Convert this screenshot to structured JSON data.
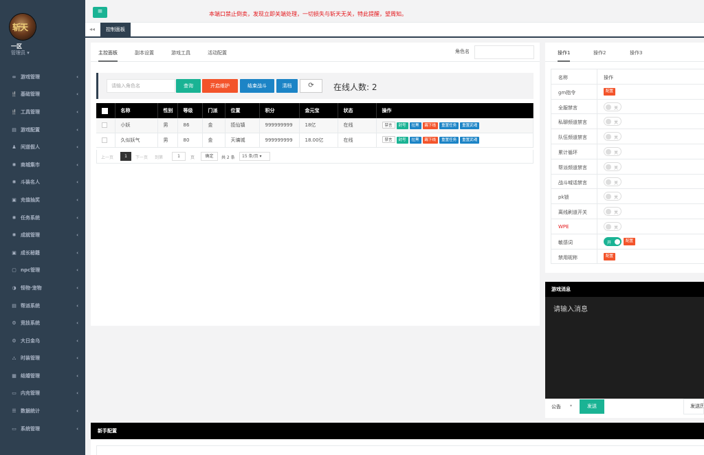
{
  "sidebar": {
    "logo_text": "斩天",
    "user": {
      "name": "一区",
      "role": "管理员 ▾"
    },
    "items": [
      {
        "icon": "∞",
        "label": "游戏管理"
      },
      {
        "icon": "🍴",
        "label": "基础管理"
      },
      {
        "icon": "🍴",
        "label": "工具管理"
      },
      {
        "icon": "▤",
        "label": "游戏配置"
      },
      {
        "icon": "♟",
        "label": "间道假人"
      },
      {
        "icon": "✺",
        "label": "商城集市"
      },
      {
        "icon": "✺",
        "label": "斗装名人"
      },
      {
        "icon": "▣",
        "label": "充值抽奖"
      },
      {
        "icon": "✺",
        "label": "任务系统"
      },
      {
        "icon": "✺",
        "label": "成就管理"
      },
      {
        "icon": "▣",
        "label": "成长秘籍"
      },
      {
        "icon": "▢",
        "label": "npc管理"
      },
      {
        "icon": "◑",
        "label": "怪物·宠物"
      },
      {
        "icon": "▤",
        "label": "帮派系统"
      },
      {
        "icon": "⚙",
        "label": "竞技系统"
      },
      {
        "icon": "⚙",
        "label": "大日金乌"
      },
      {
        "icon": "⛬",
        "label": "时装管理"
      },
      {
        "icon": "▦",
        "label": "结婚管理"
      },
      {
        "icon": "▭",
        "label": "内充管理"
      },
      {
        "icon": "☰",
        "label": "数据统计"
      },
      {
        "icon": "▭",
        "label": "系统管理"
      }
    ]
  },
  "topbar": {
    "menu_icon": "≡",
    "notice": "本端口禁止倒卖，发现立即关端处理，一切损失与斩天无关，特此提醒，望周知。"
  },
  "tabbar": {
    "back_icon": "◂◂",
    "active_tab": "控制面板"
  },
  "main": {
    "subtabs": [
      "主控面板",
      "副本设置",
      "游戏工具",
      "活动配置"
    ],
    "role_label": "角色名",
    "search_placeholder": "请输入角色名",
    "buttons": {
      "query": "查询",
      "maintenance": "开启维护",
      "end_battle": "结束战斗",
      "clear": "清档",
      "refresh": "⟳"
    },
    "online_count": "在线人数: 2",
    "table": {
      "headers": [
        "名称",
        "性别",
        "等级",
        "门派",
        "位置",
        "积分",
        "金元宝",
        "状态",
        "操作"
      ],
      "rows": [
        {
          "name": "小妖",
          "gender": "男",
          "level": "86",
          "faction": "金",
          "location": "揽仙镇",
          "points": "999999999",
          "gold": "18亿",
          "status": "在线"
        },
        {
          "name": "久似妖气",
          "gender": "男",
          "level": "80",
          "faction": "金",
          "location": "天墉城",
          "points": "999999999",
          "gold": "18.00亿",
          "status": "在线"
        }
      ],
      "actions": [
        "禁言",
        "封号",
        "拉黑",
        "踢下线",
        "重置任务",
        "重置武魂"
      ]
    },
    "pager": {
      "prev": "上一页",
      "current": "1",
      "next": "下一页",
      "goto": "到第",
      "page_input": "1",
      "page_unit": "页",
      "confirm": "确定",
      "total": "共 2 条",
      "page_size": "15 条/页 ▾"
    }
  },
  "rpanel": {
    "tabs": [
      "操作1",
      "操作2",
      "操作3"
    ],
    "header": {
      "name": "名称",
      "op": "操作"
    },
    "config_label": "配置",
    "off_label": "关",
    "on_label": "开",
    "rows": [
      {
        "name": "gm指令",
        "type": "config"
      },
      {
        "name": "全服禁言",
        "type": "off"
      },
      {
        "name": "私聊频道禁言",
        "type": "off"
      },
      {
        "name": "队伍频道禁言",
        "type": "off"
      },
      {
        "name": "累计循环",
        "type": "off"
      },
      {
        "name": "帮派频道禁言",
        "type": "off"
      },
      {
        "name": "战斗喊话禁言",
        "type": "off"
      },
      {
        "name": "pk锁",
        "type": "off"
      },
      {
        "name": "离线刷道开关",
        "type": "off"
      },
      {
        "name": "WPE",
        "type": "off",
        "red": true
      },
      {
        "name": "敏感词",
        "type": "on-config"
      },
      {
        "name": "禁用昵称",
        "type": "config"
      }
    ]
  },
  "msgpanel": {
    "title": "游戏消息",
    "placeholder": "请输入消息",
    "select": "公告",
    "caret": "▾",
    "send": "发送",
    "history": "发送历史"
  },
  "newbie": {
    "title": "新手配置"
  },
  "colors": {
    "sidebar": "#2f4050",
    "accent": "#1ab394",
    "danger": "#f3542b",
    "info": "#1c84c6",
    "notice": "#e4171b"
  }
}
